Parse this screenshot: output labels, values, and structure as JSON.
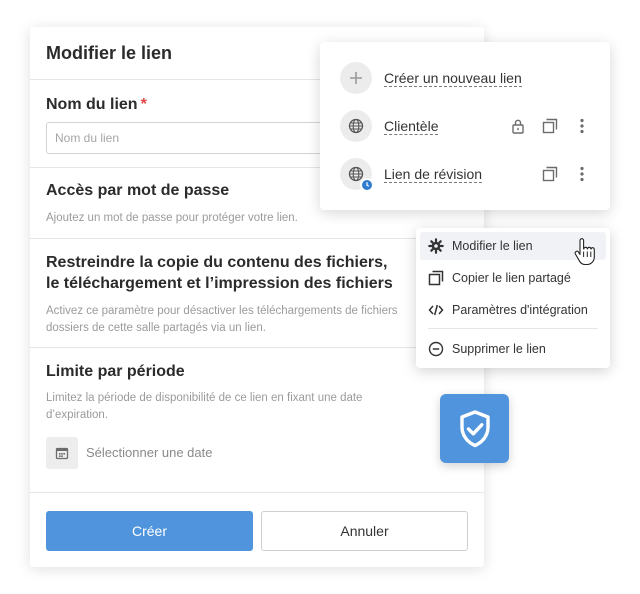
{
  "modal": {
    "title": "Modifier le lien",
    "name_section": {
      "title": "Nom du lien",
      "required_mark": "*",
      "placeholder": "Nom du lien"
    },
    "password_section": {
      "title": "Accès par mot de passe",
      "description": "Ajoutez un mot de passe pour protéger votre lien."
    },
    "restrict_section": {
      "title_line1": "Restreindre la copie du contenu des fichiers,",
      "title_line2": "le téléchargement et l’impression des fichiers",
      "desc_line1": "Activez ce paramètre pour désactiver les téléchargements de fichiers",
      "desc_line2": "dossiers de cette salle partagés via un lien."
    },
    "limit_section": {
      "title": "Limite par période",
      "desc_line1": "Limitez la période de disponibilité de ce lien en fixant une date",
      "desc_line2": "d’expiration.",
      "date_label": "Sélectionner une date",
      "date_icon": "calendar-icon"
    },
    "footer": {
      "create_label": "Créer",
      "cancel_label": "Annuler"
    }
  },
  "links_panel": {
    "create_label": "Créer un nouveau lien",
    "items": [
      {
        "label": "Clientèle",
        "icon": "globe-icon",
        "locked": true
      },
      {
        "label": "Lien de révision",
        "icon": "globe-icon",
        "badge": "clock-icon",
        "locked": false
      }
    ]
  },
  "context_menu": {
    "items": [
      {
        "label": "Modifier le lien",
        "icon": "gear-icon",
        "hovered": true
      },
      {
        "label": "Copier le lien partagé",
        "icon": "copy-icon"
      },
      {
        "label": "Paramètres d'intégration",
        "icon": "code-icon"
      },
      {
        "label": "Supprimer le lien",
        "icon": "minus-circle-icon"
      }
    ]
  },
  "colors": {
    "accent": "#4f94dc",
    "required": "#e04545",
    "badge": "#2f7bd0"
  }
}
